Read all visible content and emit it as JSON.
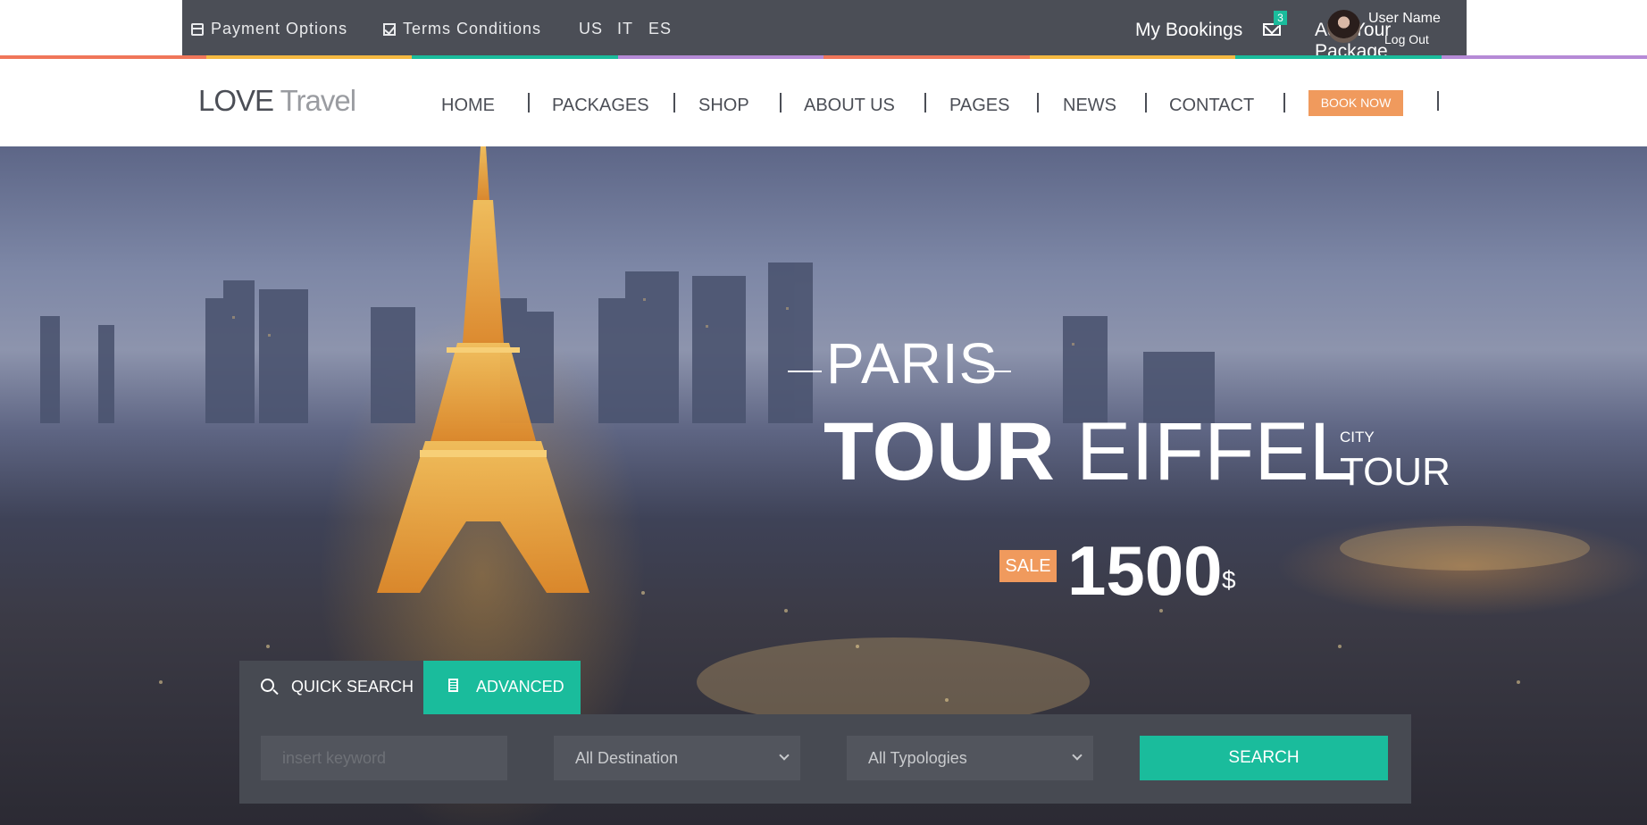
{
  "topbar": {
    "payment_label": "Payment Options",
    "terms_label": "Terms Conditions",
    "languages": [
      "US",
      "IT",
      "ES"
    ],
    "bookings_label": "My Bookings",
    "mail_count": "3",
    "add_package_label": "Add Your Package",
    "user_name": "User Name",
    "logout_label": "Log Out",
    "stripe_colors": [
      "#f0765a",
      "#f5b941",
      "#1abc9c",
      "#b58ad6",
      "#f0765a",
      "#f5b941",
      "#1abc9c",
      "#b58ad6"
    ]
  },
  "nav": {
    "logo_part1": "LOVE",
    "logo_part2": "Travel",
    "items": [
      "HOME",
      "PACKAGES",
      "SHOP",
      "ABOUT US",
      "PAGES",
      "NEWS",
      "CONTACT"
    ],
    "book_now_label": "BOOK NOW"
  },
  "hero": {
    "city": "PARIS",
    "title_bold": "TOUR",
    "title_light": "EIFFEL",
    "sub_small": "CITY",
    "sub_large": "TOUR",
    "sale_label": "SALE",
    "price": "1500",
    "currency": "$"
  },
  "search": {
    "tab_quick": "QUICK SEARCH",
    "tab_advanced": "ADVANCED",
    "keyword_placeholder": "insert keyword",
    "destination_value": "All Destination",
    "typology_value": "All Typologies",
    "search_button": "SEARCH"
  },
  "colors": {
    "accent": "#1abc9c",
    "orange": "#f09a5d",
    "dark": "#4b4e56"
  }
}
